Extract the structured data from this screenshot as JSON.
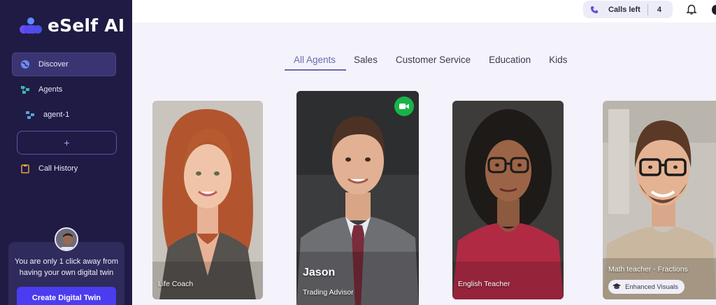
{
  "brand": {
    "name": "eSelf AI"
  },
  "sidebar": {
    "items": [
      {
        "label": "Discover",
        "icon": "globe-icon",
        "active": true
      },
      {
        "label": "Agents",
        "icon": "agents-icon"
      },
      {
        "label": "agent-1",
        "icon": "agent-icon"
      },
      {
        "label": "Call History",
        "icon": "clipboard-icon"
      }
    ],
    "add_label": "+",
    "promo_text": "You are only 1 click away from having your own digital twin",
    "create_button": "Create Digital Twin"
  },
  "topbar": {
    "calls_label": "Calls left",
    "calls_count": "4"
  },
  "tabs": [
    {
      "label": "All Agents",
      "active": true
    },
    {
      "label": "Sales"
    },
    {
      "label": "Customer Service"
    },
    {
      "label": "Education"
    },
    {
      "label": "Kids"
    }
  ],
  "agents": [
    {
      "caption": "Life Coach"
    },
    {
      "name": "Jason",
      "caption": "Trading Advisor",
      "badge": "video-icon"
    },
    {
      "caption": "English Teacher"
    },
    {
      "caption": "Math teacher - Fractions",
      "badge_label": "Enhanced Visuals"
    }
  ],
  "colors": {
    "sidebar_bg": "#1f1b45",
    "accent": "#4b3cf0",
    "tab_active": "#6a6ab0",
    "video_badge": "#19b34a"
  }
}
